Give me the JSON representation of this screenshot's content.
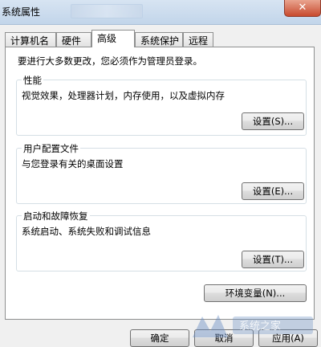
{
  "window": {
    "title": "系统属性",
    "close_glyph": "✕"
  },
  "tabs": [
    {
      "label": "计算机名",
      "active": false
    },
    {
      "label": "硬件",
      "active": false
    },
    {
      "label": "高级",
      "active": true
    },
    {
      "label": "系统保护",
      "active": false
    },
    {
      "label": "远程",
      "active": false
    }
  ],
  "admin_note": "要进行大多数更改，您必须作为管理员登录。",
  "groups": {
    "performance": {
      "title": "性能",
      "description": "视觉效果，处理器计划，内存使用，以及虚拟内存",
      "button": "设置(S)..."
    },
    "profiles": {
      "title": "用户配置文件",
      "description": "与您登录有关的桌面设置",
      "button": "设置(E)..."
    },
    "startup": {
      "title": "启动和故障恢复",
      "description": "系统启动、系统失败和调试信息",
      "button": "设置(T)..."
    }
  },
  "env_button": "环境变量(N)...",
  "footer": {
    "ok": "确定",
    "cancel": "取消",
    "apply": "应用(A)"
  },
  "colors": {
    "watermark": "#6b8fc4",
    "close": "#c84a2e"
  }
}
